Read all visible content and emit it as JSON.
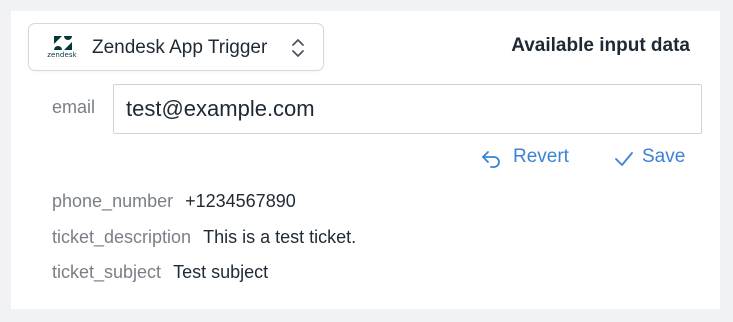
{
  "trigger": {
    "logo_text": "zendesk",
    "label": "Zendesk App Trigger"
  },
  "panel": {
    "title": "Available input data"
  },
  "email": {
    "label": "email",
    "value": "test@example.com"
  },
  "actions": {
    "revert_label": "Revert",
    "save_label": "Save"
  },
  "fields": [
    {
      "name": "phone_number",
      "value": "+1234567890"
    },
    {
      "name": "ticket_description",
      "value": "This is a test ticket."
    },
    {
      "name": "ticket_subject",
      "value": "Test subject"
    }
  ],
  "colors": {
    "accent": "#3b82d6",
    "brand": "#03363d"
  }
}
